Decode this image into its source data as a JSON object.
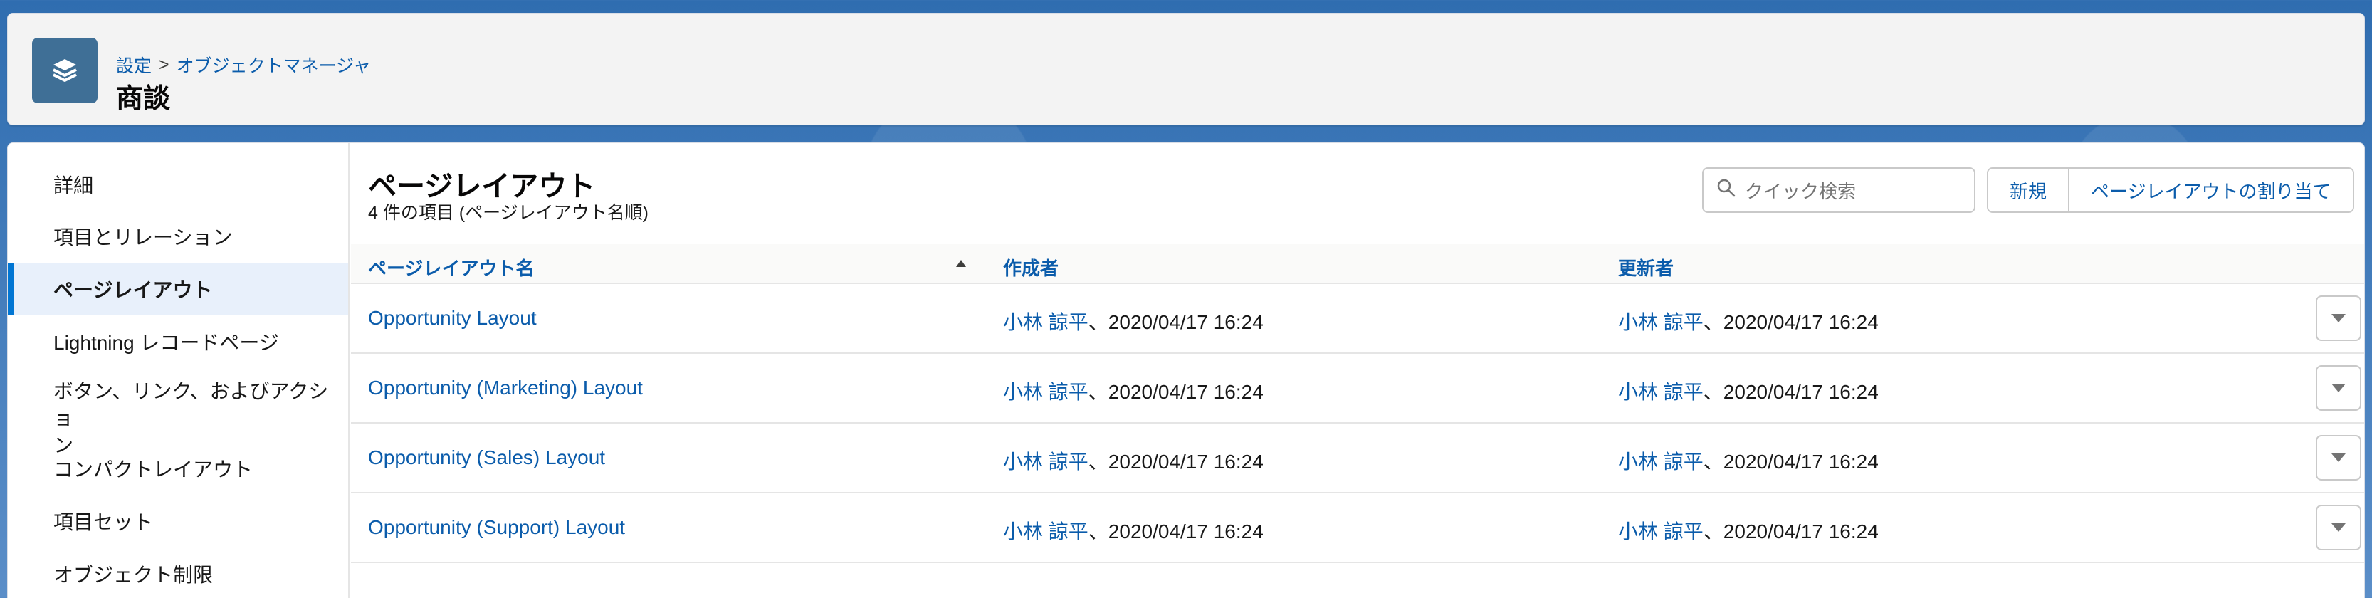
{
  "header": {
    "breadcrumb": {
      "setup": "設定",
      "separator": ">",
      "object_manager": "オブジェクトマネージャ"
    },
    "title": "商談",
    "icon": "layers-icon"
  },
  "sidebar": {
    "items": [
      {
        "label": "詳細",
        "active": false
      },
      {
        "label": "項目とリレーション",
        "active": false
      },
      {
        "label": "ページレイアウト",
        "active": true
      },
      {
        "label": "Lightning レコードページ",
        "active": false
      },
      {
        "label": "ボタン、リンク、およびアクショ",
        "label2": "ン",
        "active": false
      },
      {
        "label": "コンパクトレイアウト",
        "active": false
      },
      {
        "label": "項目セット",
        "active": false
      },
      {
        "label": "オブジェクト制限",
        "active": false
      }
    ]
  },
  "main": {
    "title": "ページレイアウト",
    "subtitle": "4 件の項目 (ページレイアウト名順)",
    "search": {
      "placeholder": "クイック検索",
      "icon": "search-icon"
    },
    "buttons": {
      "new": "新規",
      "assign": "ページレイアウトの割り当て"
    },
    "columns": {
      "name": "ページレイアウト名",
      "created_by": "作成者",
      "modified_by": "更新者"
    },
    "rows": [
      {
        "name": "Opportunity Layout",
        "created_user": "小林 諒平",
        "created_sep": "、",
        "created_date": "2020/04/17 16:24",
        "modified_user": "小林 諒平",
        "modified_sep": "、",
        "modified_date": "2020/04/17 16:24"
      },
      {
        "name": "Opportunity (Marketing) Layout",
        "created_user": "小林 諒平",
        "created_sep": "、",
        "created_date": "2020/04/17 16:24",
        "modified_user": "小林 諒平",
        "modified_sep": "、",
        "modified_date": "2020/04/17 16:24"
      },
      {
        "name": "Opportunity (Sales) Layout",
        "created_user": "小林 諒平",
        "created_sep": "、",
        "created_date": "2020/04/17 16:24",
        "modified_user": "小林 諒平",
        "modified_sep": "、",
        "modified_date": "2020/04/17 16:24"
      },
      {
        "name": "Opportunity (Support) Layout",
        "created_user": "小林 諒平",
        "created_sep": "、",
        "created_date": "2020/04/17 16:24",
        "modified_user": "小林 諒平",
        "modified_sep": "、",
        "modified_date": "2020/04/17 16:24"
      }
    ]
  },
  "colors": {
    "accent": "#0176d3",
    "link": "#0b5cab",
    "icon_bg": "#3f6f96",
    "background": "#2f6db0"
  }
}
